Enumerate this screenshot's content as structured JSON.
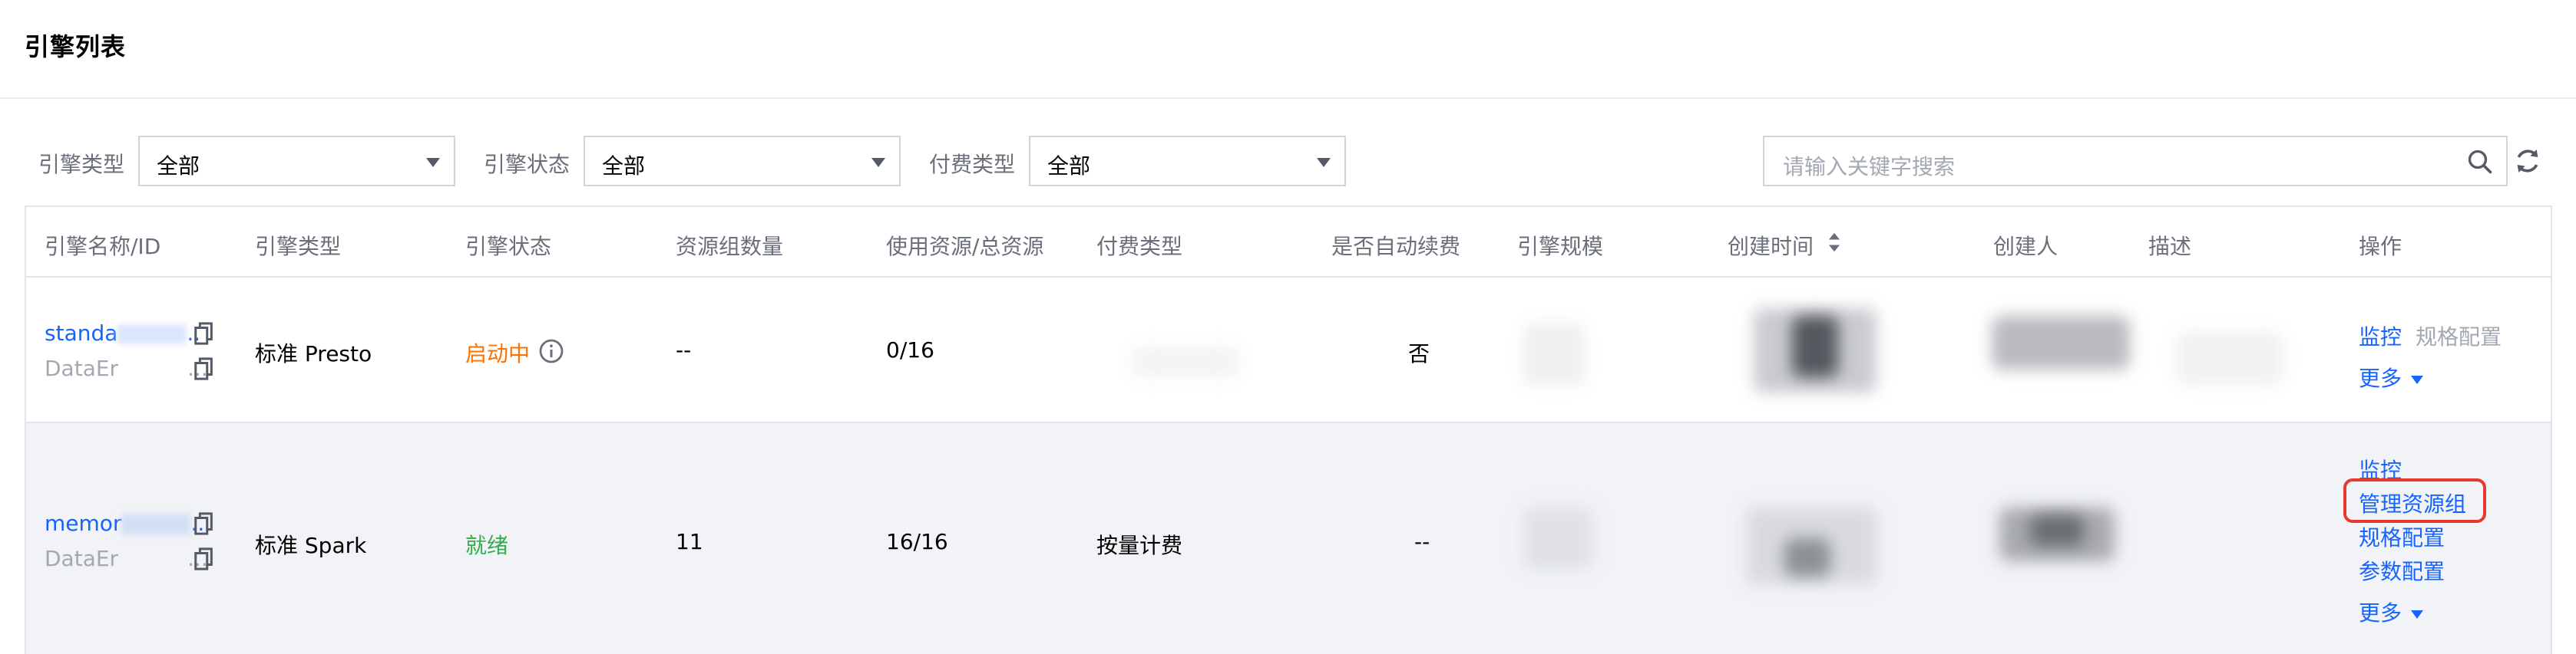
{
  "page": {
    "title": "引擎列表"
  },
  "filters": {
    "engine_type": {
      "label": "引擎类型",
      "value": "全部"
    },
    "engine_status": {
      "label": "引擎状态",
      "value": "全部"
    },
    "billing_type": {
      "label": "付费类型",
      "value": "全部"
    },
    "search": {
      "placeholder": "请输入关键字搜索"
    }
  },
  "table": {
    "headers": {
      "name_id": "引擎名称/ID",
      "type": "引擎类型",
      "status": "引擎状态",
      "resource_group_count": "资源组数量",
      "used_total": "使用资源/总资源",
      "billing": "付费类型",
      "auto_renew": "是否自动续费",
      "scale": "引擎规模",
      "created_time": "创建时间",
      "creator": "创建人",
      "description": "描述",
      "actions": "操作"
    },
    "rows": [
      {
        "name": "standa",
        "name_suffix": "..",
        "id": "DataEr",
        "id_suffix": "...",
        "type": "标准 Presto",
        "status": "启动中",
        "resource_group_count": "--",
        "used_total": "0/16",
        "billing": "",
        "auto_renew": "否",
        "actions": {
          "monitor": "监控",
          "spec_config": "规格配置",
          "more": "更多"
        }
      },
      {
        "name": "memor",
        "name_suffix": "..",
        "id": "DataEr",
        "id_suffix": "...",
        "type": "标准 Spark",
        "status": "就绪",
        "resource_group_count": "11",
        "used_total": "16/16",
        "billing": "按量计费",
        "auto_renew": "--",
        "actions": {
          "monitor": "监控",
          "manage_resource_group": "管理资源组",
          "spec_config": "规格配置",
          "param_config": "参数配置",
          "more": "更多"
        }
      }
    ]
  },
  "colors": {
    "link": "#1664ff",
    "status_starting": "#ff7200",
    "status_ready": "#2fae4b",
    "highlight": "#e63a2e"
  },
  "icons": [
    "search-icon",
    "refresh-icon",
    "copy-icon",
    "info-icon",
    "sort-icon",
    "caret-down-icon"
  ]
}
